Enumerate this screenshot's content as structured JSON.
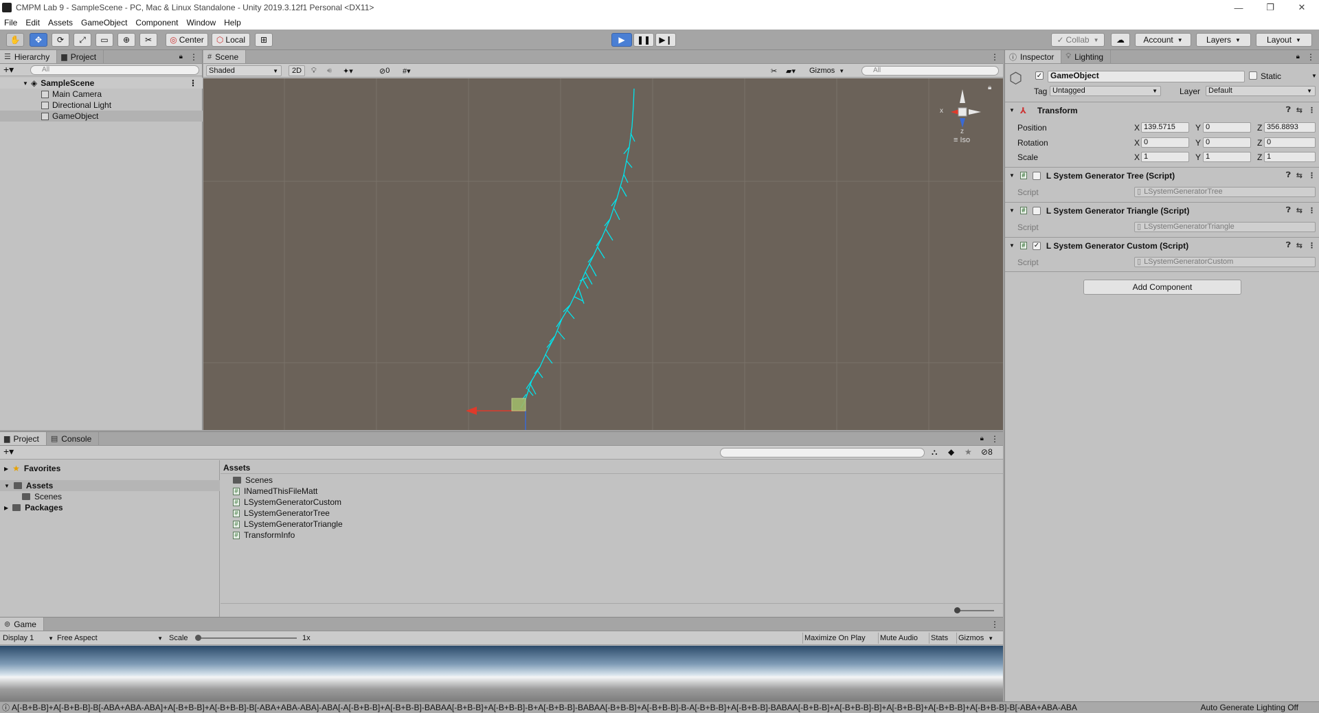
{
  "window": {
    "title": "CMPM Lab 9 - SampleScene - PC, Mac & Linux Standalone - Unity 2019.3.12f1 Personal <DX11>"
  },
  "menu": [
    "File",
    "Edit",
    "Assets",
    "GameObject",
    "Component",
    "Window",
    "Help"
  ],
  "toolbar": {
    "pivot": "Center",
    "space": "Local",
    "collab": "Collab",
    "account": "Account",
    "layers": "Layers",
    "layout": "Layout"
  },
  "hierarchy": {
    "tabs": [
      "Hierarchy",
      "Project"
    ],
    "search_placeholder": "All",
    "scene": "SampleScene",
    "items": [
      "Main Camera",
      "Directional Light",
      "GameObject"
    ]
  },
  "scene": {
    "tab": "Scene",
    "shading": "Shaded",
    "mode2d": "2D",
    "hidden_count": "0",
    "gizmos": "Gizmos",
    "search_placeholder": "All",
    "gizmo_axes": {
      "x": "x",
      "z": "z"
    },
    "projection": "Iso"
  },
  "inspector": {
    "tabs": [
      "Inspector",
      "Lighting"
    ],
    "object_name": "GameObject",
    "static_label": "Static",
    "tag_label": "Tag",
    "tag_value": "Untagged",
    "layer_label": "Layer",
    "layer_value": "Default",
    "transform": {
      "title": "Transform",
      "position": {
        "label": "Position",
        "x": "139.5715",
        "y": "0",
        "z": "356.8893"
      },
      "rotation": {
        "label": "Rotation",
        "x": "0",
        "y": "0",
        "z": "0"
      },
      "scale": {
        "label": "Scale",
        "x": "1",
        "y": "1",
        "z": "1"
      }
    },
    "components": [
      {
        "title": "L System Generator Tree (Script)",
        "script_label": "Script",
        "script": "LSystemGeneratorTree",
        "enabled": false
      },
      {
        "title": "L System Generator Triangle (Script)",
        "script_label": "Script",
        "script": "LSystemGeneratorTriangle",
        "enabled": false
      },
      {
        "title": "L System Generator Custom (Script)",
        "script_label": "Script",
        "script": "LSystemGeneratorCustom",
        "enabled": true
      }
    ],
    "add_component": "Add Component"
  },
  "project": {
    "tabs": [
      "Project",
      "Console"
    ],
    "hidden_count": "8",
    "favorites": "Favorites",
    "tree": [
      "Assets",
      "Scenes",
      "Packages"
    ],
    "breadcrumb": "Assets",
    "assets": [
      {
        "name": "Scenes",
        "kind": "folder"
      },
      {
        "name": "INamedThisFileMatt",
        "kind": "script"
      },
      {
        "name": "LSystemGeneratorCustom",
        "kind": "script"
      },
      {
        "name": "LSystemGeneratorTree",
        "kind": "script"
      },
      {
        "name": "LSystemGeneratorTriangle",
        "kind": "script"
      },
      {
        "name": "TransformInfo",
        "kind": "script"
      }
    ]
  },
  "game": {
    "tab": "Game",
    "display": "Display 1",
    "aspect": "Free Aspect",
    "scale_label": "Scale",
    "scale_value": "1x",
    "maximize": "Maximize On Play",
    "mute": "Mute Audio",
    "stats": "Stats",
    "gizmos": "Gizmos"
  },
  "status": {
    "text": "A[-B+B-B]+A[-B+B-B]-B[-ABA+ABA-ABA]+A[-B+B-B]+A[-B+B-B]-B[-ABA+ABA-ABA]-ABA[-A[-B+B-B]+A[-B+B-B]-BABAA[-B+B-B]+A[-B+B-B]-B+A[-B+B-B]-BABAA[-B+B-B]+A[-B+B-B]-B-A[-B+B-B]+A[-B+B-B]-BABAA[-B+B-B]+A[-B+B-B]-B]+A[-B+B-B]+A[-B+B-B]+A[-B+B-B]-B[-ABA+ABA-ABA",
    "lighting": "Auto Generate Lighting Off"
  },
  "colors": {
    "accent": "#4a7fd4",
    "lsystem": "#00e5ee",
    "scene_bg": "#6b6259"
  }
}
